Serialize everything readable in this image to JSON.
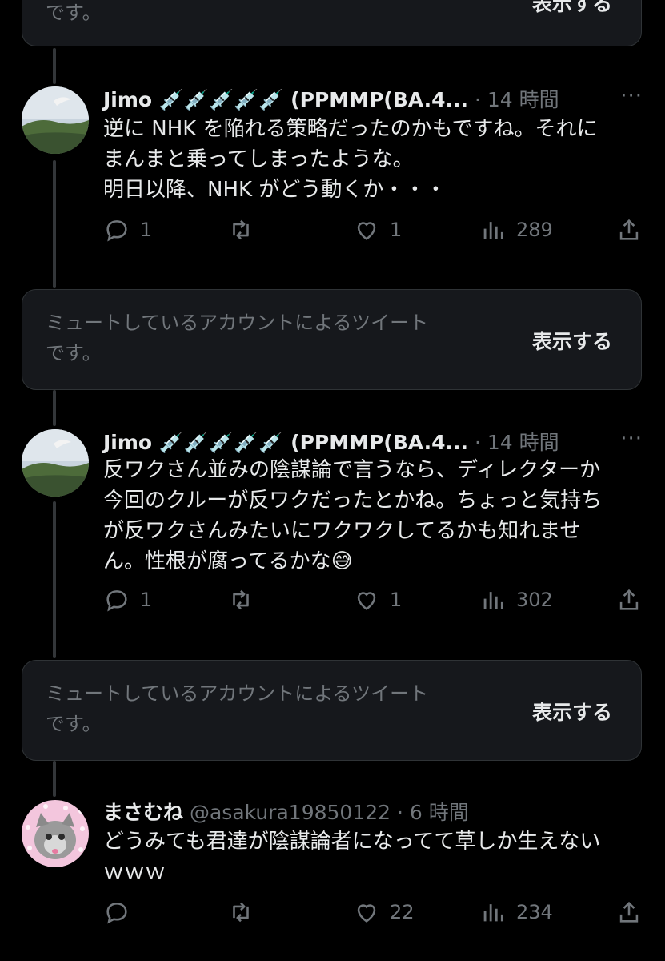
{
  "muted_notice": {
    "text": "ミュートしているアカウントによるツイートです。",
    "top_text": "です。",
    "show_label": "表示する"
  },
  "tweets": [
    {
      "name": "Jimo 💉💉💉💉💉 (PPMMP(BA.4...",
      "dot": "·",
      "time": "14 時間",
      "more": "···",
      "lines": [
        "逆に NHK を陥れる策略だったのかもですね。それに",
        "まんまと乗ってしまったような。",
        "明日以降、NHK がどう動くか・・・"
      ],
      "replies": "1",
      "retweets": "",
      "likes": "1",
      "views": "289"
    },
    {
      "name": "Jimo 💉💉💉💉💉 (PPMMP(BA.4...",
      "dot": "·",
      "time": "14 時間",
      "more": "···",
      "lines": [
        "反ワクさん並みの陰謀論で言うなら、ディレクターか",
        "今回のクルーが反ワクだったとかね。ちょっと気持ち",
        "が反ワクさんみたいにワクワクしてるかも知れませ",
        "ん。性根が腐ってるかな😅"
      ],
      "replies": "1",
      "retweets": "",
      "likes": "1",
      "views": "302"
    },
    {
      "name": "まさむね",
      "handle": "@asakura19850122",
      "dot": "·",
      "time": "6 時間",
      "lines": [
        "どうみても君達が陰謀論者になってて草しか生えない",
        "ｗｗｗ"
      ],
      "replies": "",
      "retweets": "",
      "likes": "22",
      "views": "234"
    }
  ],
  "muted_boxes": [
    {
      "line1": "ミュートしているアカウントによるツイート",
      "line2": "です。",
      "show_label": "表示する"
    },
    {
      "line1": "ミュートしているアカウントによるツイート",
      "line2": "です。",
      "show_label": "表示する"
    }
  ],
  "icons": [
    "reply-icon",
    "retweet-icon",
    "like-icon",
    "views-icon",
    "share-icon",
    "more-icon"
  ]
}
